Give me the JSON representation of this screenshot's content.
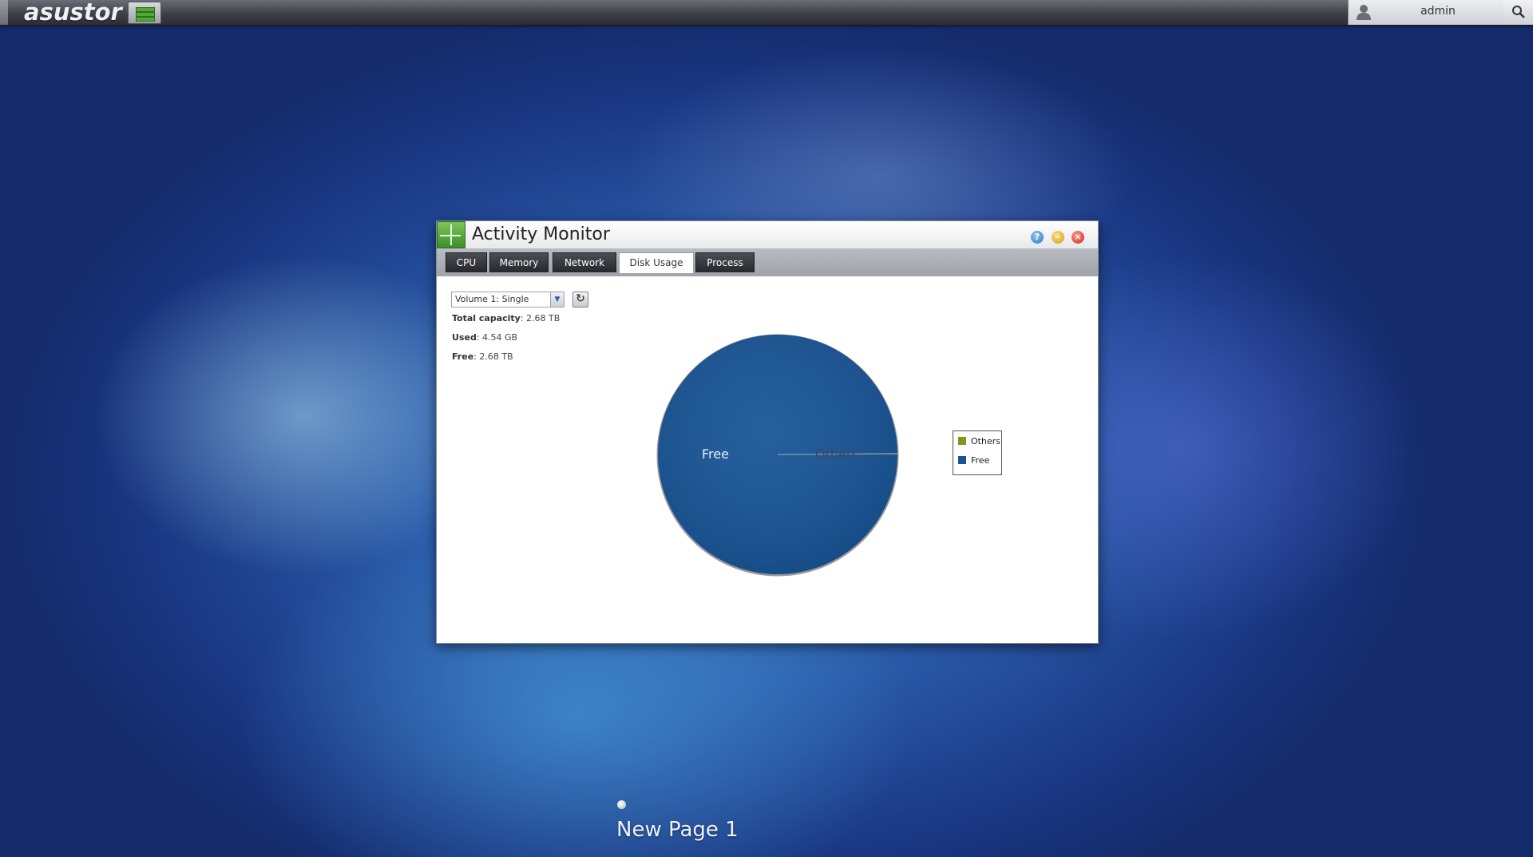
{
  "topbar": {
    "brand": "asustor",
    "user": "admin"
  },
  "window": {
    "title": "Activity Monitor",
    "buttons": {
      "help": "?",
      "minimize": "–",
      "close": "×"
    },
    "tabs": [
      {
        "label": "CPU"
      },
      {
        "label": "Memory"
      },
      {
        "label": "Network"
      },
      {
        "label": "Disk Usage",
        "active": true
      },
      {
        "label": "Process"
      }
    ]
  },
  "disk": {
    "volume_selected": "Volume 1: Single",
    "total_label": "Total capacity",
    "total_value": "2.68 TB",
    "used_label": "Used",
    "used_value": "4.54 GB",
    "free_label": "Free",
    "free_value": "2.68 TB"
  },
  "chart_data": {
    "type": "pie",
    "slices": [
      {
        "label": "Others",
        "value": 0.17,
        "color": "#7a9a1a"
      },
      {
        "label": "Free",
        "value": 99.83,
        "color": "#175496"
      }
    ],
    "legend": [
      "Others",
      "Free"
    ],
    "legend_position": "right"
  },
  "desktop": {
    "page_label": "New Page 1"
  },
  "colors": {
    "pie_free": "#175496",
    "pie_others": "#7a9a1a"
  }
}
